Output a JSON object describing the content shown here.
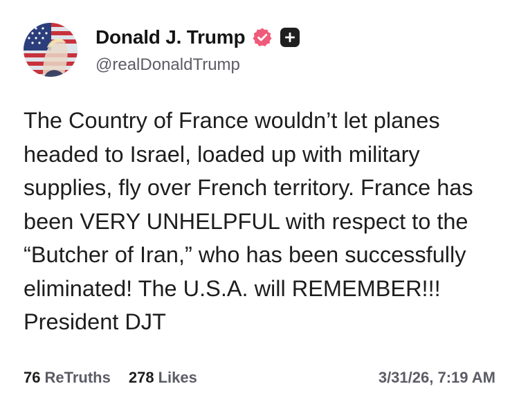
{
  "author": {
    "display_name": "Donald J. Trump",
    "handle": "@realDonaldTrump",
    "avatar_icon": "flag-portrait-avatar",
    "verified_icon": "verified-badge-icon",
    "verified_color": "#f05a7a",
    "plus_icon": "plus-badge-icon"
  },
  "post": {
    "text": "The Country of France wouldn’t let planes headed to Israel, loaded up with military supplies, fly over French territory. France has been VERY UNHELPFUL with respect to the “Butcher of Iran,” who has been successfully eliminated! The U.S.A. will REMEMBER!!! President DJT"
  },
  "stats": {
    "retruths_count": "76",
    "retruths_label": "ReTruths",
    "likes_count": "278",
    "likes_label": "Likes"
  },
  "timestamp": "3/31/26, 7:19 AM"
}
